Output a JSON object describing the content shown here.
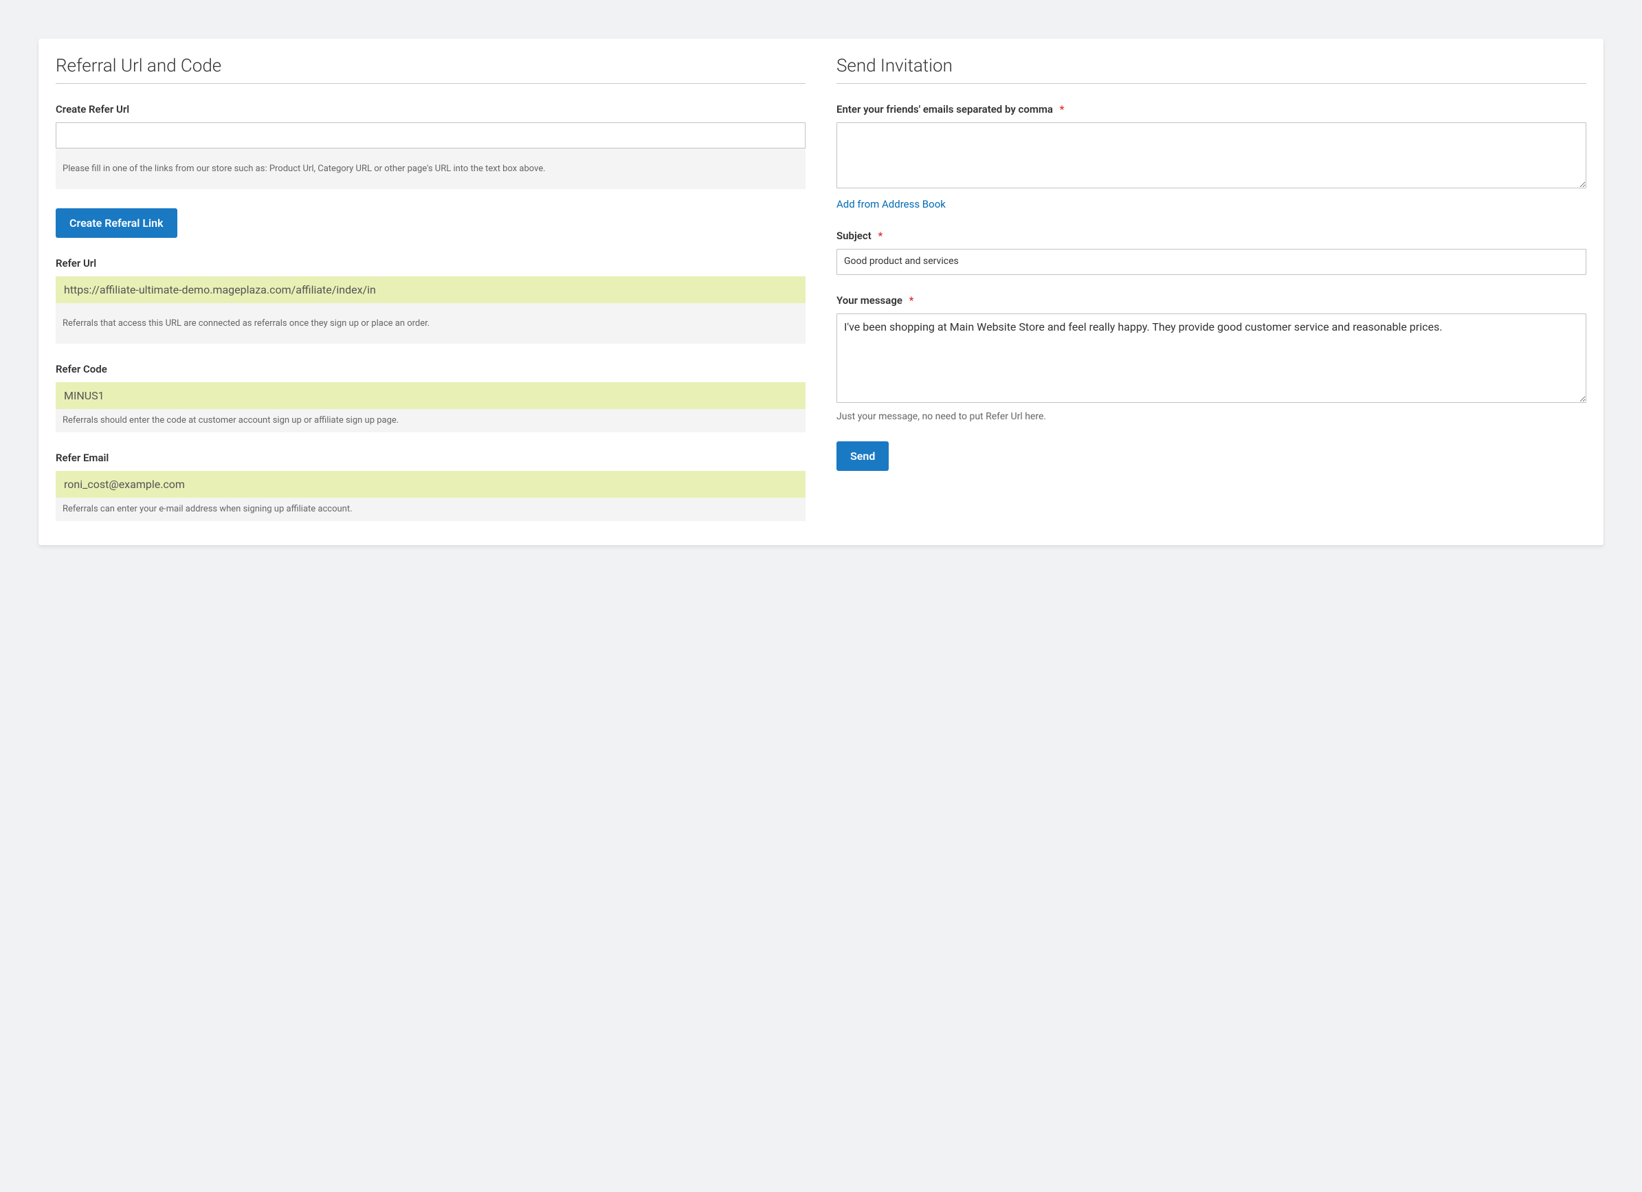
{
  "left": {
    "title": "Referral Url and Code",
    "create_url_label": "Create Refer Url",
    "create_url_value": "",
    "create_url_helper": "Please fill in one of the links from our store such as: Product Url, Category URL or other page's URL into the text box above.",
    "create_button_label": "Create Referal Link",
    "refer_url_label": "Refer Url",
    "refer_url_value": "https://affiliate-ultimate-demo.mageplaza.com/affiliate/index/in",
    "refer_url_helper": "Referrals that access this URL are connected as referrals once they sign up or place an order.",
    "refer_code_label": "Refer Code",
    "refer_code_value": "MINUS1",
    "refer_code_helper": "Referrals should enter the code at customer account sign up or affiliate sign up page.",
    "refer_email_label": "Refer Email",
    "refer_email_value": "roni_cost@example.com",
    "refer_email_helper": "Referrals can enter your e-mail address when signing up affiliate account."
  },
  "right": {
    "title": "Send Invitation",
    "emails_label": "Enter your friends' emails separated by comma",
    "emails_value": "",
    "address_book_link": "Add from Address Book",
    "subject_label": "Subject",
    "subject_value": "Good product and services",
    "message_label": "Your message",
    "message_value": "I've been shopping at Main Website Store and feel really happy. They provide good customer service and reasonable prices.",
    "message_note": "Just your message, no need to put Refer Url here.",
    "send_button_label": "Send",
    "required_mark": "*"
  }
}
